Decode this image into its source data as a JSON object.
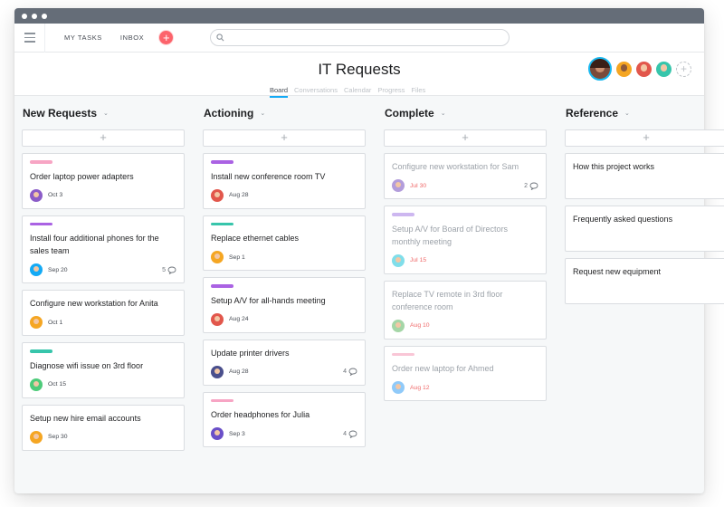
{
  "nav": {
    "my_tasks": "MY TASKS",
    "inbox": "INBOX",
    "add": "+"
  },
  "project": {
    "title": "IT Requests",
    "tabs": [
      "Board",
      "Conversations",
      "Calendar",
      "Progress",
      "Files"
    ],
    "active_tab": "Board"
  },
  "colors": {
    "accent": "#14aaf5",
    "brand_plus": "#fc636b",
    "titlebar": "#656d78"
  },
  "columns": [
    {
      "name": "New Requests",
      "cards": [
        {
          "title": "Order laptop power adapters",
          "tag": "#f7a5c4",
          "date": "Oct 3",
          "avatar": "#8b5cc8",
          "comments": ""
        },
        {
          "title": "Install four additional phones for the sales team",
          "tag": "#aa62e3",
          "date": "Sep 20",
          "avatar": "#14aaf5",
          "comments": "5"
        },
        {
          "title": "Configure new workstation for Anita",
          "tag": "",
          "date": "Oct 1",
          "avatar": "#f5a623",
          "comments": ""
        },
        {
          "title": "Diagnose wifi issue on 3rd floor",
          "tag": "#37c5ab",
          "date": "Oct 15",
          "avatar": "#4ecb7a",
          "comments": ""
        },
        {
          "title": "Setup new hire email accounts",
          "tag": "",
          "date": "Sep 30",
          "avatar": "#f5a623",
          "comments": ""
        }
      ]
    },
    {
      "name": "Actioning",
      "cards": [
        {
          "title": "Install new conference room TV",
          "tag": "#aa62e3",
          "date": "Aug 28",
          "avatar": "#e2574c",
          "comments": ""
        },
        {
          "title": "Replace ethernet cables",
          "tag": "#37c5ab",
          "date": "Sep 1",
          "avatar": "#f5a623",
          "comments": ""
        },
        {
          "title": "Setup A/V for all-hands meeting",
          "tag": "#aa62e3",
          "date": "Aug 24",
          "avatar": "#e2574c",
          "comments": ""
        },
        {
          "title": "Update printer drivers",
          "tag": "",
          "date": "Aug 28",
          "avatar": "#4a4f8c",
          "comments": "4"
        },
        {
          "title": "Order headphones for Julia",
          "tag": "#f7a5c4",
          "date": "Sep 3",
          "avatar": "#6a4fc8",
          "comments": "4"
        }
      ]
    },
    {
      "name": "Complete",
      "cards": [
        {
          "title": "Configure new workstation for Sam",
          "tag": "",
          "date": "Jul 30",
          "avatar": "#b39ddb",
          "comments": "2"
        },
        {
          "title": "Setup A/V for Board of Directors monthly meeting",
          "tag": "#cdb7f0",
          "date": "Jul 15",
          "avatar": "#80deea",
          "comments": ""
        },
        {
          "title": "Replace TV remote in 3rd floor conference room",
          "tag": "",
          "date": "Aug 10",
          "avatar": "#a5d6a7",
          "comments": ""
        },
        {
          "title": "Order new laptop for Ahmed",
          "tag": "#f9c6d6",
          "date": "Aug 12",
          "avatar": "#90caf9",
          "comments": ""
        }
      ]
    },
    {
      "name": "Reference",
      "cards": [
        {
          "title": "How this project works",
          "tag": "",
          "date": "",
          "avatar": "",
          "comments": ""
        },
        {
          "title": "Frequently asked questions",
          "tag": "",
          "date": "",
          "avatar": "",
          "comments": ""
        },
        {
          "title": "Request new equipment",
          "tag": "",
          "date": "",
          "avatar": "",
          "comments": ""
        }
      ]
    }
  ]
}
